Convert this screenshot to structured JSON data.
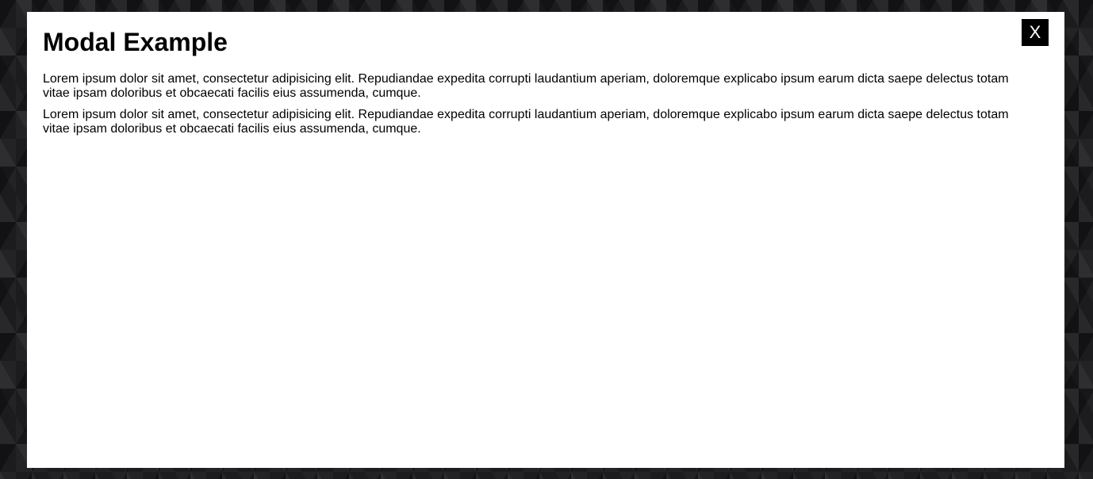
{
  "modal": {
    "title": "Modal Example",
    "close_label": "X",
    "paragraphs": [
      "Lorem ipsum dolor sit amet, consectetur adipisicing elit. Repudiandae expedita corrupti laudantium aperiam, doloremque explicabo ipsum earum dicta saepe delectus totam vitae ipsam doloribus et obcaecati facilis eius assumenda, cumque.",
      "Lorem ipsum dolor sit amet, consectetur adipisicing elit. Repudiandae expedita corrupti laudantium aperiam, doloremque explicabo ipsum earum dicta saepe delectus totam vitae ipsam doloribus et obcaecati facilis eius assumenda, cumque."
    ]
  },
  "colors": {
    "modal_background": "#ffffff",
    "close_button_background": "#000000",
    "close_button_text": "#ffffff",
    "page_background": "#1c1c1f"
  }
}
